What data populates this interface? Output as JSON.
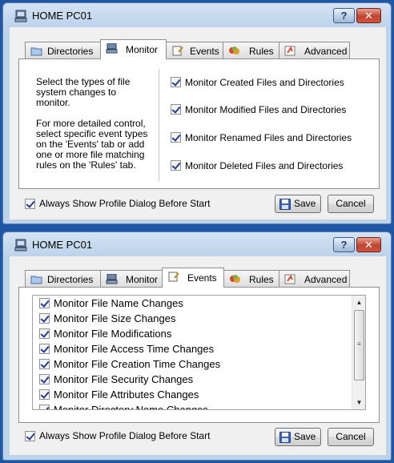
{
  "window_title": "HOME PC01",
  "title_buttons": {
    "help": "?",
    "close": "✕"
  },
  "tabs": [
    "Directories",
    "Monitor",
    "Events",
    "Rules",
    "Advanced"
  ],
  "monitor_panel": {
    "description_1": [
      "Select the types of file",
      "system changes to",
      "monitor."
    ],
    "description_2": [
      "For more detailed control,",
      "select specific event types",
      "on the 'Events' tab or add",
      "one or more file matching",
      "rules on the 'Rules' tab."
    ],
    "options": [
      "Monitor Created Files and Directories",
      "Monitor Modified Files and Directories",
      "Monitor Renamed Files and Directories",
      "Monitor Deleted Files and Directories"
    ]
  },
  "events_panel": {
    "items": [
      "Monitor File Name Changes",
      "Monitor File Size Changes",
      "Monitor File Modifications",
      "Monitor File Access Time Changes",
      "Monitor File Creation Time Changes",
      "Monitor File Security Changes",
      "Monitor File Attributes Changes",
      "Monitor Directory Name Changes"
    ]
  },
  "footer": {
    "always_show_label": "Always Show Profile Dialog Before Start",
    "save_label": "Save",
    "cancel_label": "Cancel"
  },
  "icons": {
    "app": "computer-icon",
    "directories": "folder-icon",
    "monitor": "computer-icon",
    "events": "notepad-icon",
    "rules": "rules-icon",
    "advanced": "advanced-icon",
    "save": "floppy-disk-icon"
  },
  "colors": {
    "desktop": "#1f57a6",
    "window_frame": "#bcd3ea",
    "close_button": "#c1432f",
    "check_mark": "#21399b"
  }
}
